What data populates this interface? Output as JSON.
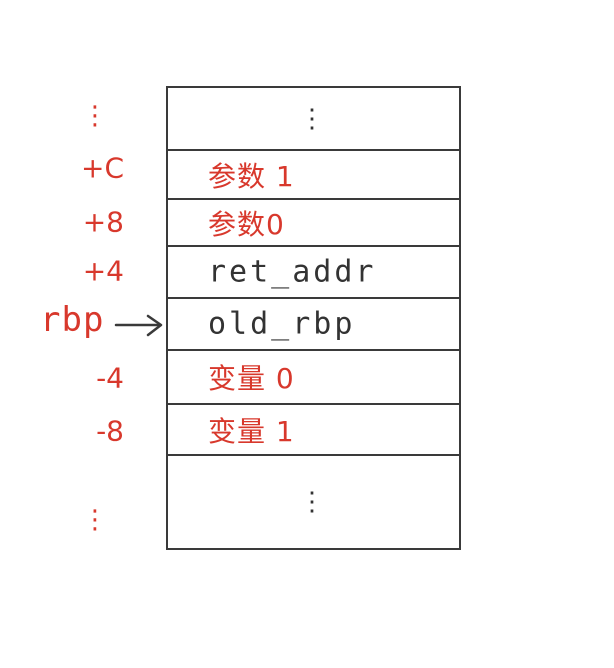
{
  "stack": {
    "slots": [
      {
        "text": "⋮",
        "color": "dark"
      },
      {
        "text": "参数 1",
        "color": "red"
      },
      {
        "text": "参数0",
        "color": "red"
      },
      {
        "text": "ret_addr",
        "color": "dark"
      },
      {
        "text": "old_rbp",
        "color": "dark"
      },
      {
        "text": "变量 0",
        "color": "red"
      },
      {
        "text": "变量 1",
        "color": "red"
      },
      {
        "text": "⋮",
        "color": "dark"
      }
    ]
  },
  "offsets": [
    "⋮",
    "+C",
    "+8",
    "+4",
    "",
    "-4",
    "-8",
    "⋮"
  ],
  "pointer": {
    "label": "rbp",
    "target_slot": 4
  },
  "colors": {
    "red": "#d8382c",
    "dark": "#333333",
    "border": "#3a3a3a"
  }
}
